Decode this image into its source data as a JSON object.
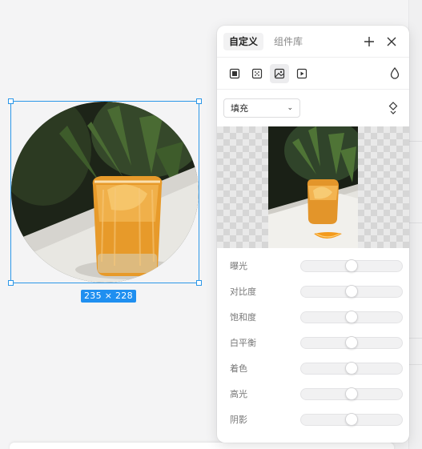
{
  "canvas": {
    "selection_size": "235 × 228"
  },
  "panel": {
    "tabs": [
      {
        "label": "自定义",
        "active": true
      },
      {
        "label": "组件库",
        "active": false
      }
    ],
    "header_icons": [
      "plus-icon",
      "close-icon"
    ],
    "mode_icons": [
      "solid-fill-icon",
      "gradient-fill-icon",
      "image-fill-icon",
      "video-fill-icon"
    ],
    "active_mode": "image-fill-icon",
    "opacity_icon": "droplet-icon",
    "fill": {
      "selected": "填充",
      "swap_icon": "swap-icon"
    },
    "adjustments": [
      {
        "label": "曝光",
        "value": 0.5
      },
      {
        "label": "对比度",
        "value": 0.5
      },
      {
        "label": "饱和度",
        "value": 0.5
      },
      {
        "label": "白平衡",
        "value": 0.5
      },
      {
        "label": "着色",
        "value": 0.5
      },
      {
        "label": "高光",
        "value": 0.5
      },
      {
        "label": "阴影",
        "value": 0.5
      }
    ]
  },
  "colors": {
    "accent": "#1f8ff0",
    "selection": "#2b97e8"
  }
}
